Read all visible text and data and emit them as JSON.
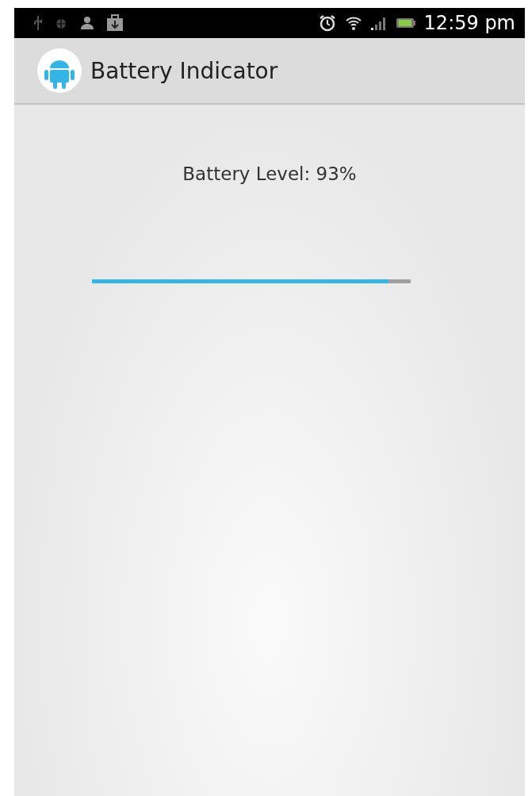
{
  "status_bar": {
    "time": "12:59 pm"
  },
  "action_bar": {
    "title": "Battery Indicator"
  },
  "content": {
    "label": "Battery Level: 93%",
    "progress": {
      "level": 0.93
    }
  }
}
